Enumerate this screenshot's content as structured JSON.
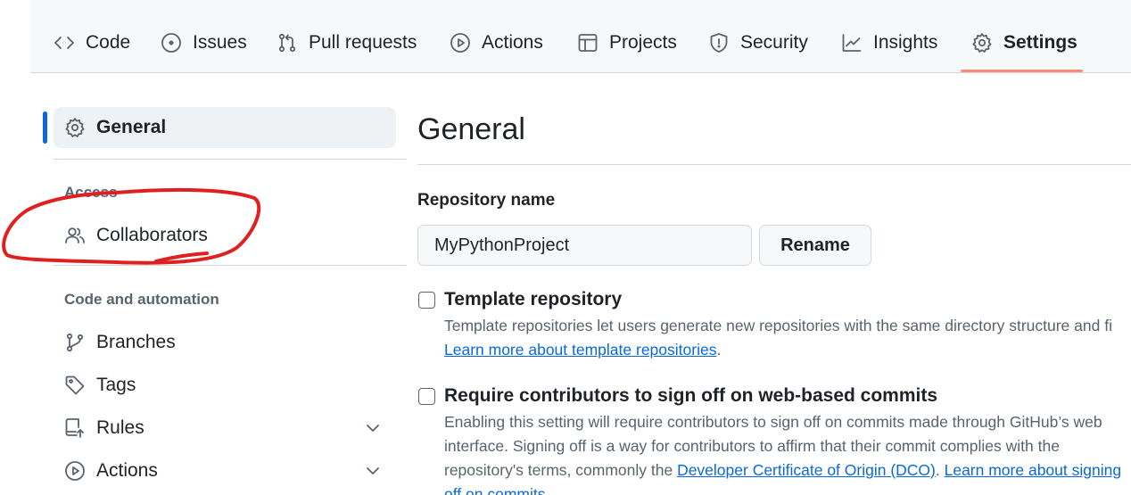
{
  "repo_nav": {
    "tabs": [
      {
        "label": "Code"
      },
      {
        "label": "Issues"
      },
      {
        "label": "Pull requests"
      },
      {
        "label": "Actions"
      },
      {
        "label": "Projects"
      },
      {
        "label": "Security"
      },
      {
        "label": "Insights"
      },
      {
        "label": "Settings",
        "selected": true
      }
    ]
  },
  "sidebar": {
    "general": "General",
    "access_heading": "Access",
    "collaborators": "Collaborators",
    "code_automation_heading": "Code and automation",
    "branches": "Branches",
    "tags": "Tags",
    "rules": "Rules",
    "actions": "Actions"
  },
  "main": {
    "title": "General",
    "repo_name_label": "Repository name",
    "repo_name_value": "MyPythonProject",
    "rename_button": "Rename",
    "template": {
      "title": "Template repository",
      "checked": false,
      "desc": "Template repositories let users generate new repositories with the same directory structure and fi",
      "link": "Learn more about template repositories",
      "link_suffix": "."
    },
    "signoff": {
      "title": "Require contributors to sign off on web-based commits",
      "checked": false,
      "desc_line1": "Enabling this setting will require contributors to sign off on commits made through GitHub’s web",
      "desc_line2": "interface. Signing off is a way for contributors to affirm that their commit complies with the",
      "desc_line3_prefix": "repository's terms, commonly the ",
      "dco_link": "Developer Certificate of Origin (DCO)",
      "desc_line3_mid": ". ",
      "learn_link": "Learn more about signing",
      "desc_line4": "off on commits"
    }
  },
  "colors": {
    "accent_underline": "#fd8c73",
    "link": "#0969da",
    "active_indicator": "#0969da",
    "annotation": "#e02020"
  }
}
